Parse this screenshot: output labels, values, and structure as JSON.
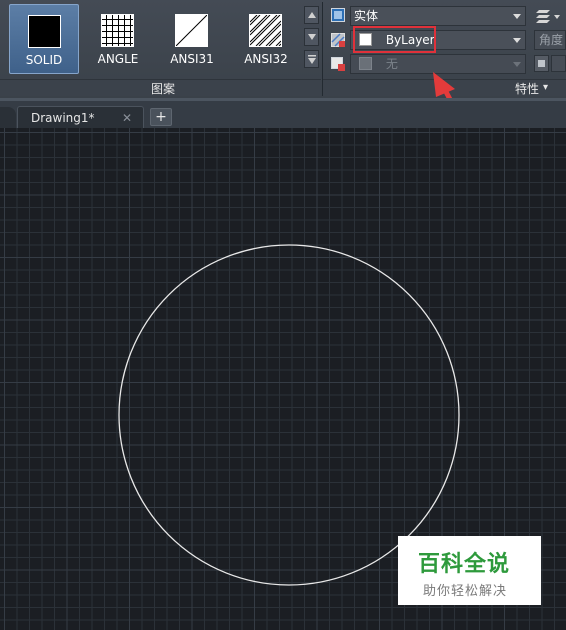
{
  "ribbon": {
    "pattern_panel": {
      "title": "图案",
      "patterns": [
        {
          "label": "SOLID",
          "selected": true
        },
        {
          "label": "ANGLE",
          "selected": false
        },
        {
          "label": "ANSI31",
          "selected": false
        },
        {
          "label": "ANSI32",
          "selected": false
        }
      ]
    },
    "properties_panel": {
      "title": "特性",
      "title_arrow": "▾",
      "pattern_type": "实体",
      "color_value": "ByLayer",
      "background_value": "无",
      "angle_label": "角度"
    }
  },
  "tabs": {
    "items": [
      {
        "label": "Drawing1*",
        "close": "✕"
      }
    ],
    "add_label": "+"
  },
  "watermark": {
    "title": "百科全说",
    "subtitle": "助你轻松解决"
  },
  "colors": {
    "highlight": "#e0313a",
    "canvas_bg": "#1b1e23",
    "circle": "#e8e8e8",
    "watermark_green": "#2e9a3c"
  }
}
